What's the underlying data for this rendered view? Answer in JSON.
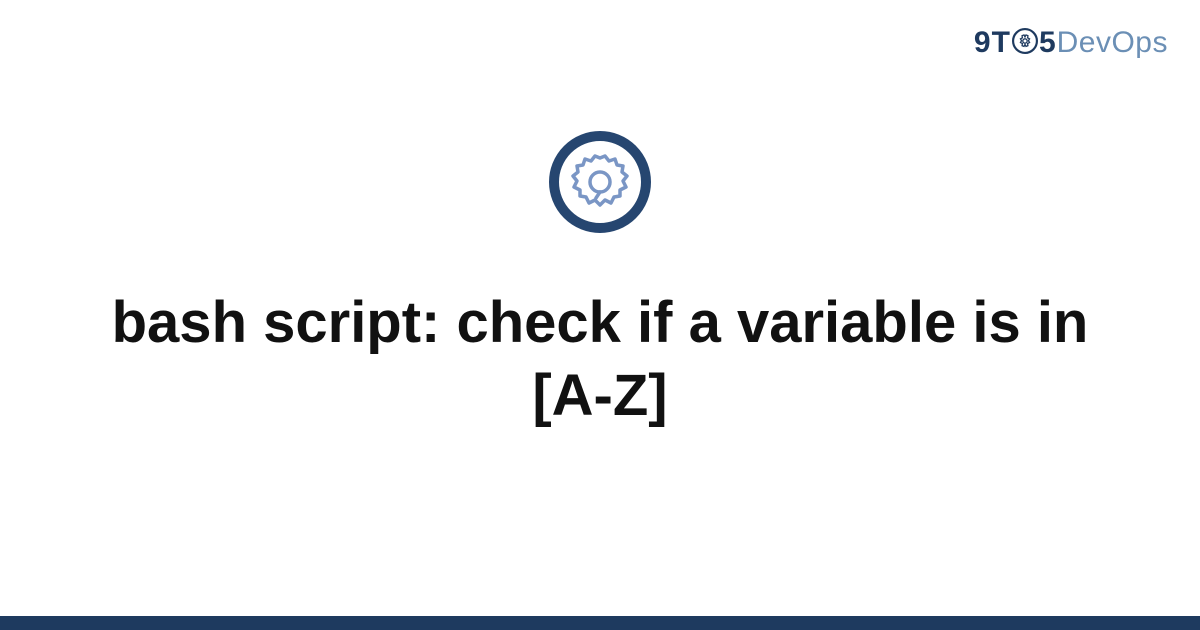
{
  "brand": {
    "part1": "9T",
    "part2": "5",
    "part3": "DevOps",
    "icon_name": "gear-icon"
  },
  "main_icon": {
    "name": "gear-circle-icon"
  },
  "title": "bash script: check if a variable is in [A-Z]",
  "colors": {
    "brand_dark": "#1e3a5f",
    "brand_light": "#6b8fb5",
    "icon_outer": "#264670",
    "icon_inner": "#7a96c5",
    "bottom_bar": "#1e3a5f"
  }
}
